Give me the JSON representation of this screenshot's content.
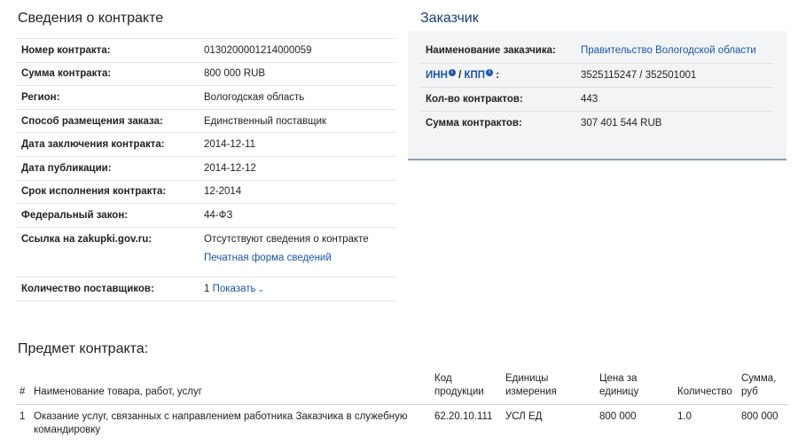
{
  "contract": {
    "title": "Сведения о контракте",
    "rows": [
      {
        "label": "Номер контракта:",
        "value": "0130200001214000059"
      },
      {
        "label": "Сумма контракта:",
        "value": "800 000 RUB"
      },
      {
        "label": "Регион:",
        "value": "Вологодская область"
      },
      {
        "label": "Способ размещения заказа:",
        "value": "Единственный поставщик"
      },
      {
        "label": "Дата заключения контракта:",
        "value": "2014-12-11"
      },
      {
        "label": "Дата публикации:",
        "value": "2014-12-12"
      },
      {
        "label": "Срок исполнения контракта:",
        "value": "12-2014"
      },
      {
        "label": "Федеральный закон:",
        "value": "44-ФЗ"
      }
    ],
    "link_row": {
      "label": "Ссылка на zakupki.gov.ru:",
      "value": "Отсутствуют сведения о контракте",
      "print_link": "Печатная форма сведений"
    },
    "suppliers_row": {
      "label": "Количество поставщиков:",
      "count": "1",
      "show_link": "Показать"
    }
  },
  "customer": {
    "title": "Заказчик",
    "name_label": "Наименование заказчика:",
    "name_value": "Правительство Вологодской области",
    "inn_label": "ИНН",
    "kpp_label": "КПП",
    "slash": " / ",
    "colon": ":",
    "inn_kpp_value": "3525115247 / 352501001",
    "contracts_count_label": "Кол-во контрактов:",
    "contracts_count_value": "443",
    "contracts_sum_label": "Сумма контрактов:",
    "contracts_sum_value": "307 401 544 RUB"
  },
  "subject": {
    "title": "Предмет контракта:",
    "headers": {
      "num": "#",
      "name": "Наименование товара, работ, услуг",
      "code": "Код продукции",
      "unit": "Единицы измерения",
      "price": "Цена за единицу",
      "qty": "Количество",
      "sum": "Сумма, руб"
    },
    "rows": [
      {
        "num": "1",
        "name": "Оказание услуг, связанных с направлением работника Заказчика в служебную командировку",
        "code": "62.20.10.111",
        "unit": "УСЛ ЕД",
        "price": "800 000",
        "qty": "1.0",
        "sum": "800 000"
      }
    ]
  }
}
